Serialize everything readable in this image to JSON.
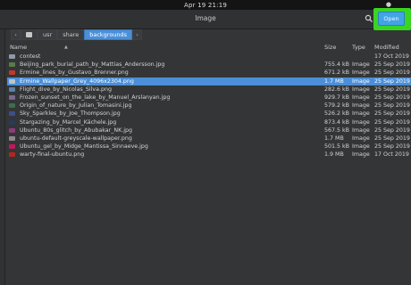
{
  "topbar": {
    "clock": "Apr 19  21:19"
  },
  "header": {
    "title": "Image",
    "open_label": "Open"
  },
  "pathbar": {
    "segments": [
      "usr",
      "share",
      "backgrounds"
    ]
  },
  "columns": {
    "name": "Name",
    "size": "Size",
    "type": "Type",
    "modified": "Modified"
  },
  "files": [
    {
      "name": "contest",
      "size": "",
      "type": "",
      "modified": "17 Oct 2019",
      "icon": "folder-icon",
      "color": "#8f9aa3"
    },
    {
      "name": "Beijing_park_burial_path_by_Mattias_Andersson.jpg",
      "size": "755.4 kB",
      "type": "Image",
      "modified": "25 Sep 2019",
      "icon": "image-icon",
      "color": "#5a7a4c"
    },
    {
      "name": "Ermine_lines_by_Gustavo_Brenner.png",
      "size": "671.2 kB",
      "type": "Image",
      "modified": "25 Sep 2019",
      "icon": "image-icon",
      "color": "#c0392b"
    },
    {
      "name": "Ermine_Wallpaper_Grey_4096x2304.png",
      "size": "1.7 MB",
      "type": "Image",
      "modified": "25 Sep 2019",
      "icon": "image-icon",
      "color": "#bfc4c8"
    },
    {
      "name": "Flight_dive_by_Nicolas_Silva.png",
      "size": "282.6 kB",
      "type": "Image",
      "modified": "25 Sep 2019",
      "icon": "image-icon",
      "color": "#5e7fa8"
    },
    {
      "name": "Frozen_sunset_on_the_lake_by_Manuel_Arslanyan.jpg",
      "size": "929.7 kB",
      "type": "Image",
      "modified": "25 Sep 2019",
      "icon": "image-icon",
      "color": "#7b6a8f"
    },
    {
      "name": "Origin_of_nature_by_Julian_Tomasini.jpg",
      "size": "579.2 kB",
      "type": "Image",
      "modified": "25 Sep 2019",
      "icon": "image-icon",
      "color": "#3f6d4a"
    },
    {
      "name": "Sky_Sparkles_by_Joe_Thompson.jpg",
      "size": "526.2 kB",
      "type": "Image",
      "modified": "25 Sep 2019",
      "icon": "image-icon",
      "color": "#3b4f8a"
    },
    {
      "name": "Stargazing_by_Marcel_Kächele.jpg",
      "size": "873.4 kB",
      "type": "Image",
      "modified": "25 Sep 2019",
      "icon": "image-icon",
      "color": "#2a3a5a"
    },
    {
      "name": "Ubuntu_80s_glitch_by_Abubakar_NK.jpg",
      "size": "567.5 kB",
      "type": "Image",
      "modified": "25 Sep 2019",
      "icon": "image-icon",
      "color": "#8e3a7a"
    },
    {
      "name": "ubuntu-default-greyscale-wallpaper.png",
      "size": "1.7 MB",
      "type": "Image",
      "modified": "25 Sep 2019",
      "icon": "image-icon",
      "color": "#8a8a8a"
    },
    {
      "name": "Ubuntu_gel_by_Midge_Mantissa_Sinnaeve.jpg",
      "size": "501.5 kB",
      "type": "Image",
      "modified": "25 Sep 2019",
      "icon": "image-icon",
      "color": "#c2185b"
    },
    {
      "name": "warty-final-ubuntu.png",
      "size": "1.9 MB",
      "type": "Image",
      "modified": "17 Oct 2019",
      "icon": "image-icon",
      "color": "#b3261e"
    }
  ],
  "selected_index": 3,
  "colors": {
    "accent": "#4a8fd8",
    "highlight": "#39d523",
    "open_button": "#41a4e6"
  }
}
